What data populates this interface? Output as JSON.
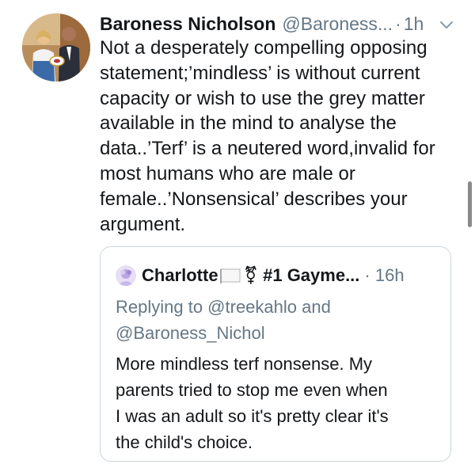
{
  "tweet": {
    "author_name": "Baroness Nicholson",
    "handle": "@Baroness...",
    "separator": "·",
    "time": "1h",
    "avatar_icon": "profile-photo-icon",
    "caret_icon": "chevron-down-icon",
    "text_lines": [
      "Not a desperately compelling opposing",
      "statement;’mindless’ is without current",
      "capacity or wish to use the grey matter",
      "available in the mind to analyse the",
      "data..’Terf’ is a neutered word,invalid for",
      "most humans who are male or",
      "female..’Nonsensical’ describes  your",
      "argument."
    ]
  },
  "quoted_tweet": {
    "author_name": "Charlotte",
    "author_name_rest": "⚧ #1 Gayme...",
    "separator": "·",
    "time": "16h",
    "flag_icon": "white-flag-icon",
    "avatar_icon": "profile-photo-icon",
    "replying_lines": [
      "Replying to @treekahlo and",
      "@Baroness_Nichol"
    ],
    "text_lines": [
      "More mindless terf nonsense. My",
      "parents tried to stop me even when",
      "I was an adult so it's pretty clear it's",
      "the child's choice."
    ]
  },
  "colors": {
    "primary_text": "#14171a",
    "secondary_text": "#657786",
    "card_border": "#ccd6dd"
  }
}
